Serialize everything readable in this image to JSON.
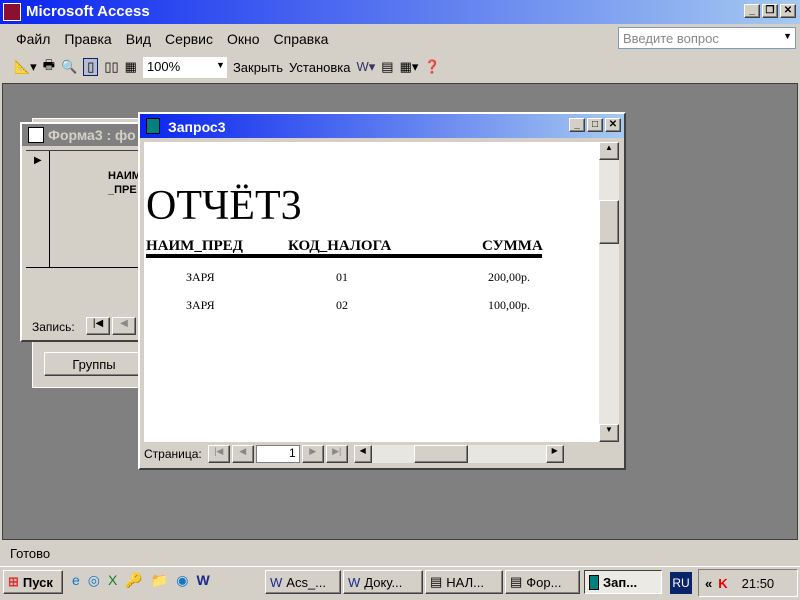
{
  "app": {
    "title": "Microsoft Access"
  },
  "menu": [
    "Файл",
    "Правка",
    "Вид",
    "Сервис",
    "Окно",
    "Справка"
  ],
  "help_placeholder": "Введите вопрос",
  "toolbar": {
    "zoom": "100%",
    "close": "Закрыть",
    "setup": "Установка"
  },
  "form_window": {
    "title": "Форма3 : фо",
    "field": "НАИМ _ПРЕ",
    "record_label": "Запись:",
    "groups_button": "Группы"
  },
  "report_window": {
    "title": "Запрос3",
    "report_title": "ОТЧЁТ3",
    "columns": [
      "НАИМ_ПРЕД",
      "КОД_НАЛОГА",
      "СУММА"
    ],
    "rows": [
      [
        "ЗАРЯ",
        "01",
        "200,00р."
      ],
      [
        "ЗАРЯ",
        "02",
        "100,00р."
      ]
    ],
    "page_label": "Страница:",
    "page": "1"
  },
  "status": "Готово",
  "taskbar": {
    "start": "Пуск",
    "items": [
      "Acs_...",
      "Доку...",
      "НАЛ...",
      "Фор...",
      "Зап..."
    ],
    "lang": "RU",
    "clock": "21:50",
    "chevron": "«"
  }
}
